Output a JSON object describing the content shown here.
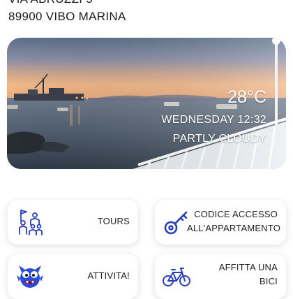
{
  "address": {
    "street": "VIA ABRUZZI 5",
    "city": "89900 VIBO MARINA"
  },
  "weather": {
    "temperature": "28°C",
    "day_time": "WEDNESDAY 12:32",
    "condition": "PARTLY CLOUDY"
  },
  "tiles": [
    {
      "label": "TOURS",
      "icon": "tour-group-icon"
    },
    {
      "label": "CODICE ACCESSO ALL'APPARTAMENTO",
      "icon": "key-icon"
    },
    {
      "label": "ATTIVITA!",
      "icon": "monster-icon"
    },
    {
      "label": "AFFITTA UNA BICI",
      "icon": "bicycle-icon"
    }
  ],
  "colors": {
    "icon_blue": "#2a3fb8",
    "monster_blue": "#2c4bd8",
    "text": "#222222"
  }
}
